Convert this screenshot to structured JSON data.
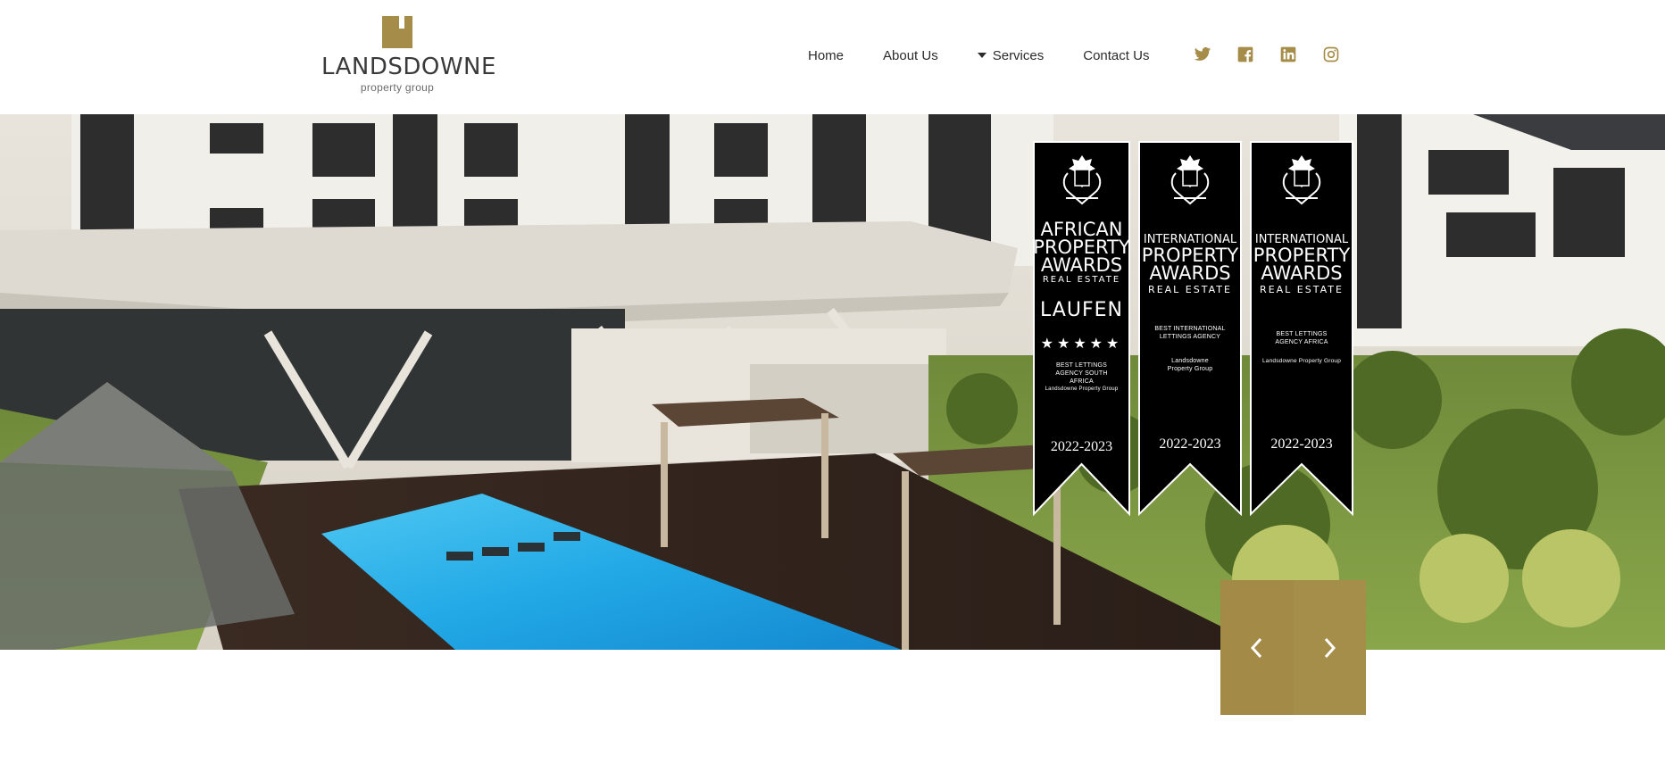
{
  "brand": {
    "name": "LANDSDOWNE",
    "tagline": "property group",
    "accent_color": "#a58d49"
  },
  "nav": {
    "items": [
      {
        "label": "Home",
        "has_dropdown": false
      },
      {
        "label": "About Us",
        "has_dropdown": false
      },
      {
        "label": "Services",
        "has_dropdown": true
      },
      {
        "label": "Contact Us",
        "has_dropdown": false
      }
    ]
  },
  "social": {
    "icons": [
      "twitter-icon",
      "facebook-icon",
      "linkedin-icon",
      "instagram-icon"
    ]
  },
  "hero": {
    "awards": [
      {
        "title_lines": [
          "AFRICAN",
          "PROPERTY",
          "AWARDS"
        ],
        "subtitle": "REAL ESTATE",
        "sponsor": "LAUFEN",
        "stars": "★★★★★",
        "category": "BEST LETTINGS AGENCY SOUTH AFRICA",
        "winner": "Landsdowne Property Group",
        "year": "2022-2023"
      },
      {
        "title_lines": [
          "INTERNATIONAL",
          "PROPERTY",
          "AWARDS"
        ],
        "subtitle": "REAL ESTATE",
        "category": "BEST INTERNATIONAL LETTINGS AGENCY",
        "winner": "Landsdowne Property Group",
        "year": "2022-2023"
      },
      {
        "title_lines": [
          "INTERNATIONAL",
          "PROPERTY",
          "AWARDS"
        ],
        "subtitle": "REAL ESTATE",
        "category": "BEST LETTINGS AGENCY AFRICA",
        "winner": "Landsdowne Property Group",
        "year": "2022-2023"
      }
    ]
  },
  "slider": {
    "prev_icon": "chevron-left-icon",
    "next_icon": "chevron-right-icon"
  }
}
